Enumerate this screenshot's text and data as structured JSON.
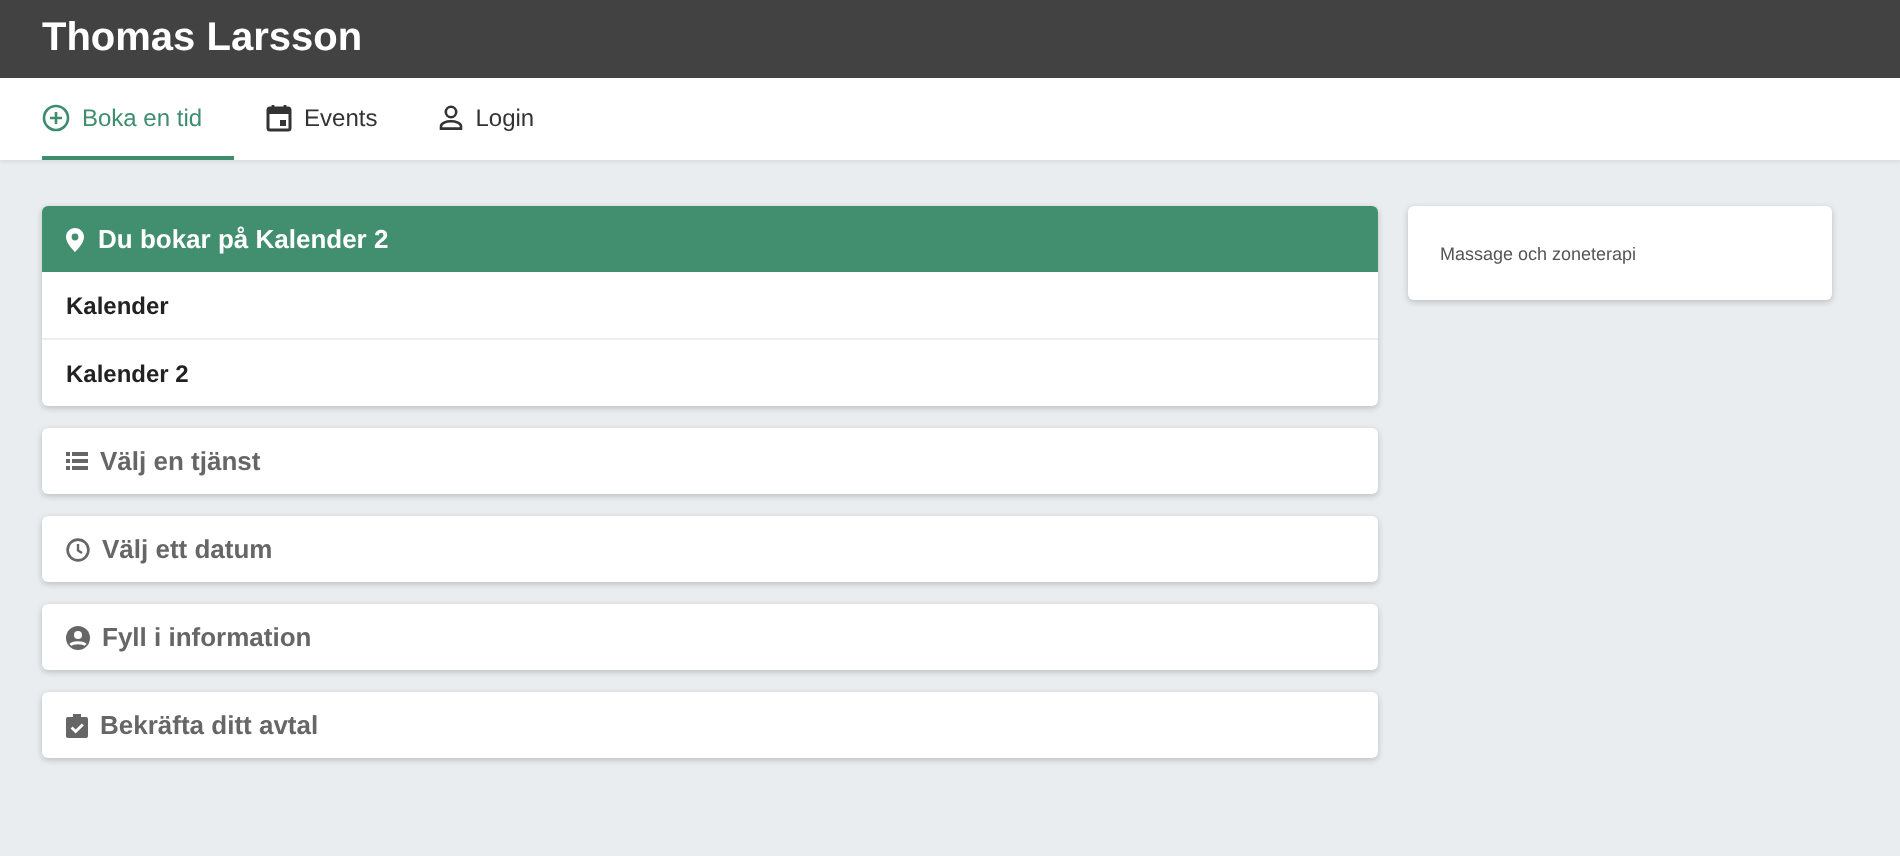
{
  "header": {
    "title": "Thomas Larsson"
  },
  "tabs": [
    {
      "label": "Boka en tid",
      "kind": "plus",
      "selected": true
    },
    {
      "label": "Events",
      "kind": "calendar",
      "selected": false
    },
    {
      "label": "Login",
      "kind": "person",
      "selected": false
    }
  ],
  "calendar_panel": {
    "title": "Du bokar på Kalender 2",
    "items": [
      "Kalender",
      "Kalender 2"
    ]
  },
  "steps": [
    {
      "label": "Välj en tjänst",
      "kind": "list"
    },
    {
      "label": "Välj ett datum",
      "kind": "clock"
    },
    {
      "label": "Fyll i information",
      "kind": "person"
    },
    {
      "label": "Bekräfta ditt avtal",
      "kind": "clipboard"
    }
  ],
  "side_card": {
    "text": "Massage och zoneterapi"
  }
}
